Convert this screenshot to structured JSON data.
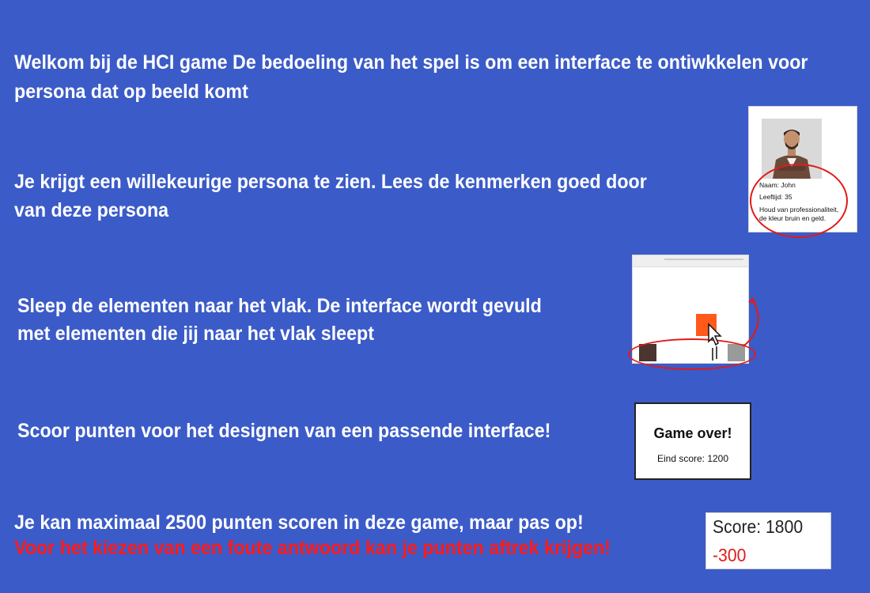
{
  "intro": {
    "line1": "Welkom bij de HCI game De bedoeling van het spel is om een interface te ontiwkkelen voor",
    "line2": "persona dat op beeld komt"
  },
  "step_persona": {
    "line1": "Je krijgt een willekeurige persona te zien. Lees de kenmerken goed door",
    "line2": "van deze persona"
  },
  "step_drag": {
    "line1": "Sleep de elementen naar het vlak. De interface wordt gevuld",
    "line2": "met elementen die jij naar het vlak sleept"
  },
  "step_score": {
    "line1": "Scoor punten voor het designen van een passende interface!"
  },
  "warning": {
    "line1": "Je kan maximaal 2500 punten scoren in deze game, maar pas op!",
    "line2": "Voor het kiezen van een foute antwoord kan je punten aftrek krijgen!"
  },
  "persona_card": {
    "name": "Naam: John",
    "age": "Leeftijd: 35",
    "likes_line1": "Houd van professionaliteit,",
    "likes_line2": "de kleur bruin en geld."
  },
  "gameover_card": {
    "title": "Game over!",
    "final_score": "Eind score: 1200"
  },
  "score_box": {
    "score": "Score: 1800",
    "penalty": "-300"
  },
  "colors": {
    "background": "#3b5bc8",
    "accent_red": "#e01b1b",
    "brown_block": "#4a3530",
    "orange_block": "#ff5a1a",
    "gray_block": "#9a9a9a"
  },
  "icons": {
    "cursor": "hand-pointer-icon",
    "arrow": "curved-arrow-icon"
  }
}
